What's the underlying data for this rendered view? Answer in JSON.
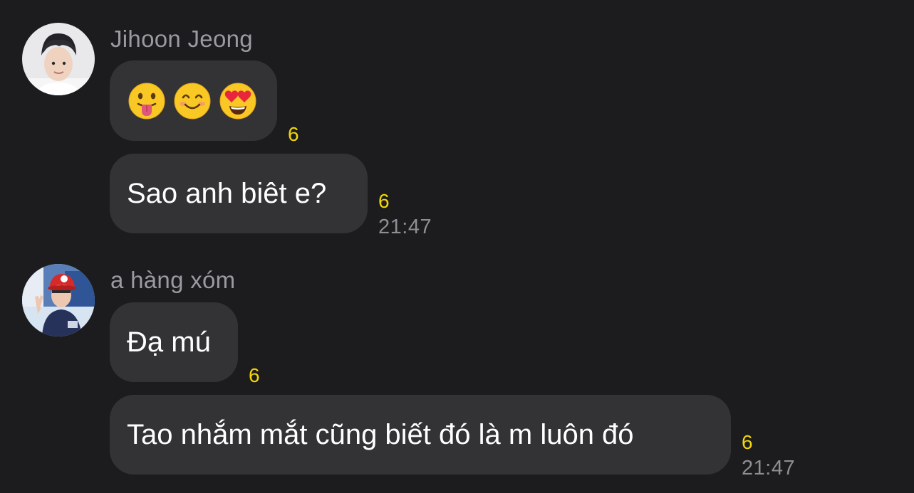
{
  "messages": [
    {
      "sender": "Jihoon Jeong",
      "avatar": "user-avatar-jihoon",
      "bubbles": [
        {
          "type": "emoji",
          "emojis": [
            "tongue-out-emoji",
            "smiling-emoji",
            "heart-eyes-emoji"
          ],
          "count": "6"
        },
        {
          "type": "text",
          "text": "Sao anh biêt e?",
          "count": "6",
          "time": "21:47"
        }
      ]
    },
    {
      "sender": "a hàng xóm",
      "avatar": "user-avatar-neighbor",
      "bubbles": [
        {
          "type": "text",
          "text": "Đạ mú",
          "count": "6"
        },
        {
          "type": "text",
          "text": "Tao nhắm mắt cũng biết đó là m luôn đó",
          "count": "6",
          "time": "21:47"
        }
      ]
    }
  ],
  "colors": {
    "background": "#1c1c1e",
    "bubble": "#333336",
    "sender_text": "#9a9aa0",
    "count_text": "#f2d70a",
    "time_text": "#8e8e93"
  }
}
